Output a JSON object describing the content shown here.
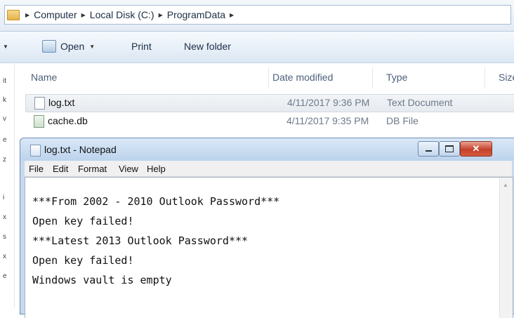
{
  "address": {
    "crumbs": [
      "Computer",
      "Local Disk (C:)",
      "ProgramData"
    ]
  },
  "toolbar": {
    "open_label": "Open",
    "print_label": "Print",
    "new_folder_label": "New folder"
  },
  "nav": {
    "glyphs": [
      "it",
      "k",
      "v",
      "e",
      "z",
      "i",
      "x",
      "s",
      "x",
      "e"
    ]
  },
  "file_list": {
    "columns": [
      "Name",
      "Date modified",
      "Type",
      "Size"
    ],
    "rows": [
      {
        "name": "log.txt",
        "date": "4/11/2017 9:36 PM",
        "type": "Text Document",
        "icon": "text-file-icon"
      },
      {
        "name": "cache.db",
        "date": "4/11/2017 9:35 PM",
        "type": "DB File",
        "icon": "db-file-icon"
      }
    ]
  },
  "notepad": {
    "title": "log.txt - Notepad",
    "menu": [
      "File",
      "Edit",
      "Format",
      "View",
      "Help"
    ],
    "lines": [
      "***From 2002 - 2010 Outlook Password***",
      "Open key failed!",
      "***Latest 2013 Outlook Password***",
      "Open key failed!",
      "Windows vault is empty"
    ],
    "close_glyph": "✕"
  }
}
